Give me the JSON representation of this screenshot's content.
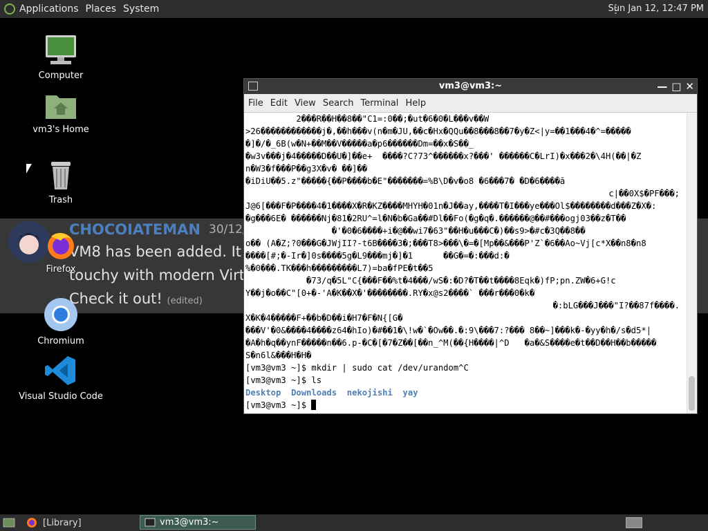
{
  "top_panel": {
    "menus": [
      "Applications",
      "Places",
      "System"
    ],
    "clock": "Sun Jan 12, 12:47 PM"
  },
  "desktop_icons": [
    {
      "label": "Computer",
      "icon": "computer-icon"
    },
    {
      "label": "vm3's Home",
      "icon": "home-folder-icon"
    },
    {
      "label": "Trash",
      "icon": "trash-icon"
    },
    {
      "label": "Firefox",
      "icon": "firefox-icon"
    },
    {
      "label": "Chromium",
      "icon": "chromium-icon"
    },
    {
      "label": "Visual Studio Code",
      "icon": "vscode-icon"
    }
  ],
  "notification": {
    "username": "CHOCOIATEMAN",
    "date": "30/12/",
    "lines": [
      "VM8 has been added. It",
      "touchy with modern Virt",
      "Check it out!"
    ],
    "edited": "(edited)"
  },
  "terminal": {
    "title": "vm3@vm3:~",
    "menu": [
      "File",
      "Edit",
      "View",
      "Search",
      "Terminal",
      "Help"
    ],
    "garbage_lines": [
      "          2���R��H��8��\"C1=:0��;�ut�6�0�L���v��W",
      ">26������������j�,��h���v(n�m�JU,��c�Hx�QQu��8���8��7�y�Z<|y=��1���4�^=�����",
      "�]�/�_6B(w�N+��M��V�����a�p6������Dm=��x�S��_",
      "�w3v���j�4�����D��U�]��e+  ����?C?73^������x?���' ������C�LrI)�x���2�\\4H(��|�Z",
      "n�W3�f���P��g3X�v� ��]��",
      "�iDiU��5.z\"�����{��P����b�E\"�������=%B\\D�v�o8 �6���7� �D�6����ā",
      "c|��0X$�PF���;",
      "J@6[���F�P����4�1����X�R�KZ����MHYH�01n�J��ay,����T�I���ye���Ol$��������d���Z�X�:",
      "�g���6E� ������Nj�81�2RU^=l�N�b�Ga��#Dl��Fo(�g�q�.������@��#���ogj03��z�T��",
      "                 �'�0�6����+i�@��wi7�63\"��H�u���C�)��s9>�#c�3Q��8��",
      "o�� (A�Z;?0���G�JWjII?-t6B����3�;���T8>���\\�=�[Mp��&���P'Z`�6��Ao~Vj[c*X��n8�n8",
      "����[#;�-Ir�]0s����5g�L9���mj�]�1      ��G�=�:���d:�",
      "%�0���.TK���h���������L7)=ba�fPE�t��5",
      "            �73/q�5L\"C{���F��%t�4���/wS�:�D?�T��t����8Eqk�)fP;pn.ZW�6+G!c",
      "Y��j�o��C\"[0+�-'A�K��X�'��������.RY�x@s2����` ���r���0�k�",
      "�:bLG���J���\"I?��87f����.",
      "X�K�4�����F+��b�D��i�H7�F�N{[G�",
      "���V'�0&����4����z64�hIo)�#��1�\\!w�`�Ow��.�:9\\���7:?��� 8��~]���k�-�yy�h�/s�d5*|",
      "�A�h�q��ynF�����n��6.p-�C�[�7�Z��[��n_^M(��{H����|^D   �a�&S����e�t��D��H��b�����",
      "S�n6l&���H�H�"
    ],
    "prompt": "[vm3@vm3 ~]$ ",
    "cmd1": "mkdir | sudo cat /dev/urandom^C",
    "cmd2": "ls",
    "ls_dirs": [
      "Desktop",
      "Downloads",
      "nekojishi"
    ],
    "ls_dir_last": "yay"
  },
  "bottom_panel": {
    "library_label": "[Library]",
    "task_label": "vm3@vm3:~"
  }
}
